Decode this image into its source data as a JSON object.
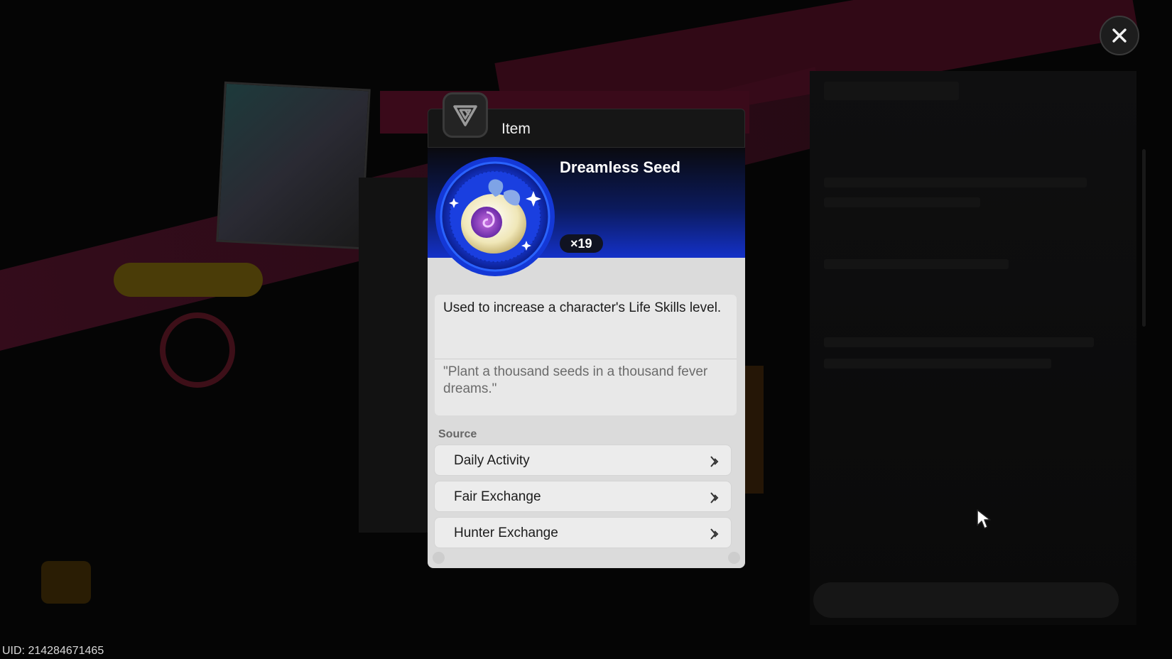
{
  "hud": {
    "uid": "UID: 214284671465"
  },
  "dialog": {
    "header_title": "Item",
    "item_name": "Dreamless Seed",
    "quantity": "×19",
    "description": "Used to increase a character's Life Skills level.",
    "flavor_text": "\"Plant a thousand seeds in a thousand fever dreams.\"",
    "source_label": "Source",
    "sources": [
      {
        "label": "Daily Activity"
      },
      {
        "label": "Fair Exchange"
      },
      {
        "label": "Hunter Exchange"
      }
    ]
  },
  "icons": {
    "close": "close-icon",
    "emblem": "item-category-emblem-icon",
    "item": "dreamless-seed-icon",
    "chevron": "chevron-right-icon",
    "cursor": "mouse-cursor-icon"
  },
  "colors": {
    "hero_blue": "#1431c8",
    "body_gray": "#dbdbdb",
    "header_dark": "#161616"
  }
}
